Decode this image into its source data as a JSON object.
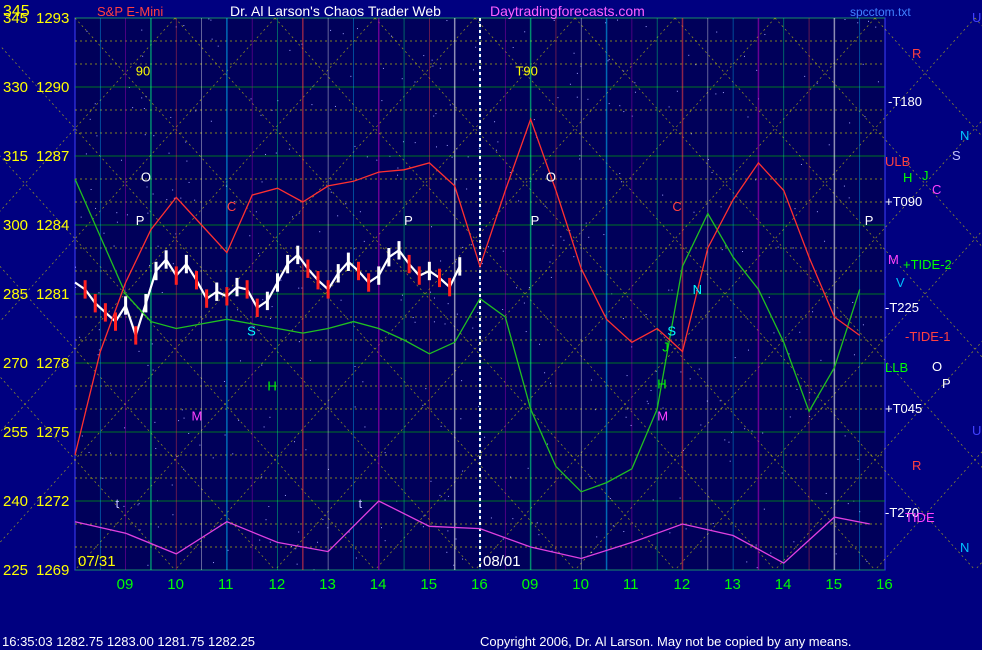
{
  "header": {
    "instrument": "S&P E-Mini",
    "title": "Dr. Al Larson's Chaos Trader Web",
    "site": "Daytradingforecasts.com",
    "file": "spcctom.txt"
  },
  "footer": {
    "quote": "16:35:03  1282.75 1283.00 1281.75 1282.25",
    "copyright": "Copyright 2006, Dr. Al Larson. May not be copied by any means."
  },
  "colors": {
    "background": "#000080",
    "plot_bg": "#00005a",
    "price_up": "#ffffff",
    "price_down": "#ff2020",
    "grid_green": "#00c000",
    "grid_yellow": "#d8d800",
    "ema_green": "#20c020",
    "ema_red": "#ff3030",
    "tide_magenta": "#e040e0",
    "axis_yellow": "#ffff00",
    "hour_green": "#00ff00"
  },
  "chart_data": {
    "type": "line",
    "xlabel": "",
    "ylabel": "",
    "dates": [
      "07/31",
      "08/01"
    ],
    "hour_ticks": [
      "09",
      "10",
      "11",
      "12",
      "13",
      "14",
      "15",
      "16",
      "09",
      "10",
      "11",
      "12",
      "13",
      "14",
      "15",
      "16"
    ],
    "y_ticks_left": [
      "345",
      "330",
      "315",
      "300",
      "285",
      "270",
      "255",
      "240",
      "225"
    ],
    "y_ticks_price": [
      "1293",
      "1290",
      "1287",
      "1284",
      "1281",
      "1278",
      "1275",
      "1272",
      "1269"
    ],
    "ylim": [
      1269,
      1293
    ],
    "right_labels": [
      "R",
      "-T180",
      "N",
      "S",
      "ULB",
      "J",
      "H",
      "C",
      "+T090",
      "M",
      "+TIDE-2",
      "V",
      "-T225",
      "-TIDE-1",
      "LLB",
      "O",
      "P",
      "+T045",
      "U",
      "R",
      "-T270",
      "TIDE",
      "N",
      "U"
    ],
    "plot_markers": [
      "90",
      "T90",
      "O",
      "O",
      "P",
      "P",
      "P",
      "P",
      "C",
      "C",
      "M",
      "M",
      "S",
      "S",
      "H",
      "H",
      "J",
      "N",
      "t",
      "t"
    ],
    "series": [
      {
        "name": "price",
        "x": [
          0,
          0.2,
          0.4,
          0.6,
          0.8,
          1.0,
          1.2,
          1.4,
          1.6,
          1.8,
          2.0,
          2.2,
          2.4,
          2.6,
          2.8,
          3.0,
          3.2,
          3.4,
          3.6,
          3.8,
          4.0,
          4.2,
          4.4,
          4.6,
          4.8,
          5.0,
          5.2,
          5.4,
          5.6,
          5.8,
          6.0,
          6.2,
          6.4,
          6.6,
          6.8,
          7.0,
          7.2,
          7.4,
          7.6
        ],
        "values": [
          1281.5,
          1281.2,
          1280.6,
          1280.2,
          1279.8,
          1280.5,
          1279.2,
          1280.6,
          1282.0,
          1282.5,
          1281.8,
          1282.3,
          1281.6,
          1280.8,
          1281.1,
          1280.9,
          1281.3,
          1281.2,
          1280.4,
          1280.7,
          1281.5,
          1282.3,
          1282.7,
          1282.1,
          1281.6,
          1281.2,
          1281.9,
          1282.4,
          1282.0,
          1281.5,
          1281.8,
          1282.6,
          1282.9,
          1282.3,
          1281.8,
          1282.0,
          1281.7,
          1281.3,
          1282.2
        ]
      },
      {
        "name": "",
        "x": [
          0,
          0.5,
          1,
          1.5,
          2,
          2.5,
          3,
          3.5,
          4,
          4.5,
          5,
          5.5,
          6,
          6.5,
          7,
          7.5,
          8,
          8.5,
          9,
          9.5,
          10,
          10.5,
          11,
          11.5,
          12,
          12.5,
          13,
          13.5,
          14,
          14.5,
          15,
          15.5
        ],
        "values": [
          1286.0,
          1283.5,
          1281.0,
          1279.8,
          1279.5,
          1279.7,
          1279.9,
          1279.7,
          1279.5,
          1279.3,
          1279.5,
          1279.8,
          1279.5,
          1279.0,
          1278.4,
          1278.9,
          1280.8,
          1280.0,
          1276.0,
          1273.5,
          1272.4,
          1272.8,
          1273.4,
          1276.0,
          1282.2,
          1284.5,
          1282.6,
          1281.2,
          1278.9,
          1275.9,
          1277.8,
          1281.2
        ]
      },
      {
        "name": "",
        "x": [
          0,
          0.5,
          1,
          1.5,
          2,
          2.5,
          3,
          3.5,
          4,
          4.5,
          5,
          5.5,
          6,
          6.5,
          7,
          7.5,
          8,
          8.5,
          9,
          9.5,
          10,
          10.5,
          11,
          11.5,
          12,
          12.5,
          13,
          13.5,
          14,
          14.5,
          15,
          15.5
        ],
        "values": [
          1274.0,
          1278.5,
          1281.5,
          1283.8,
          1285.2,
          1284.0,
          1282.8,
          1285.3,
          1285.6,
          1285.0,
          1285.7,
          1285.9,
          1286.3,
          1286.4,
          1286.7,
          1285.7,
          1282.2,
          1285.5,
          1288.6,
          1285.5,
          1282.1,
          1279.9,
          1278.9,
          1279.5,
          1278.5,
          1283.0,
          1285.1,
          1286.7,
          1285.5,
          1282.6,
          1280.0,
          1279.2
        ]
      },
      {
        "name": "",
        "x": [
          0,
          1,
          2,
          3,
          4,
          5,
          6,
          7,
          8,
          9,
          10,
          11,
          12,
          13,
          14,
          15,
          15.7
        ],
        "values": [
          1271.1,
          1270.6,
          1269.7,
          1271.1,
          1270.2,
          1269.8,
          1272.0,
          1270.9,
          1270.8,
          1270.0,
          1269.5,
          1270.2,
          1271.0,
          1270.5,
          1269.3,
          1271.3,
          1271.0
        ]
      }
    ],
    "grid": true
  }
}
